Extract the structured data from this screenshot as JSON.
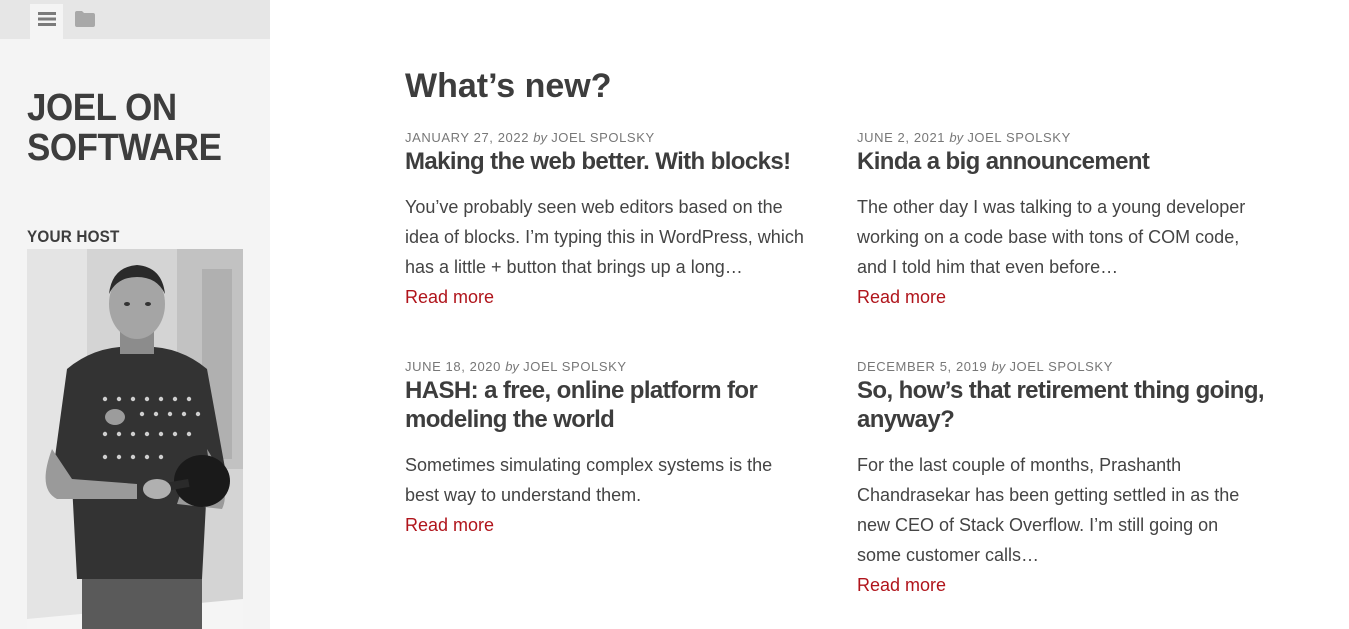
{
  "sidebar": {
    "tabs": [
      {
        "icon": "menu-icon"
      },
      {
        "icon": "folder-icon"
      }
    ],
    "site_title_line1": "JOEL ON",
    "site_title_line2": "SOFTWARE",
    "host_heading": "YOUR HOST"
  },
  "main": {
    "page_title": "What’s new?",
    "posts": [
      {
        "date": "JANUARY 27, 2022",
        "by": "by",
        "author": "JOEL SPOLSKY",
        "title": "Making the web better. With blocks!",
        "excerpt": "You’ve probably seen web editors based on the idea of blocks. I’m typing this in WordPress, which has a little + button that brings up a long…",
        "read_more": "Read more"
      },
      {
        "date": "JUNE 2, 2021",
        "by": "by",
        "author": "JOEL SPOLSKY",
        "title": "Kinda a big announcement",
        "excerpt": "The other day I was talking to a young developer working on a code base with tons of COM code, and I told him that even before…",
        "read_more": "Read more"
      },
      {
        "date": "JUNE 18, 2020",
        "by": "by",
        "author": "JOEL SPOLSKY",
        "title": "HASH: a free, online platform for modeling the world",
        "excerpt": "Sometimes simulating complex systems is the best way to understand them.",
        "read_more": "Read more"
      },
      {
        "date": "DECEMBER 5, 2019",
        "by": "by",
        "author": "JOEL SPOLSKY",
        "title": "So, how’s that retirement thing going, anyway?",
        "excerpt": "For the last couple of months, Prashanth Chandrasekar has been getting settled in as the new CEO of Stack Overflow. I’m still going on some customer calls…",
        "read_more": "Read more"
      }
    ]
  },
  "colors": {
    "link": "#b0141b",
    "sidebar_bg": "#f4f4f4",
    "tabbar_bg": "#e6e6e6",
    "text": "#3d3d3d"
  }
}
